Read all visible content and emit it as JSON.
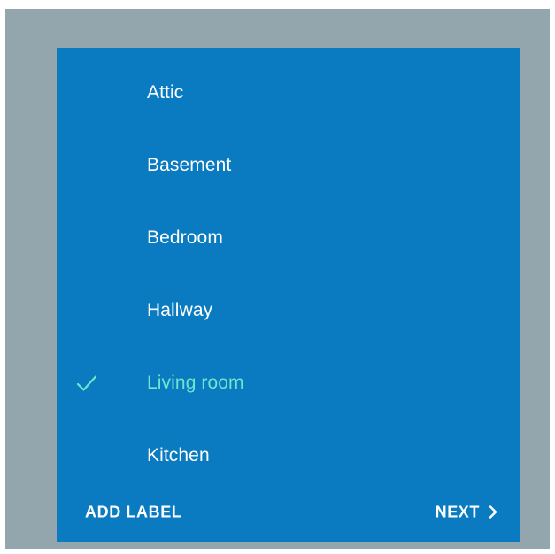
{
  "colors": {
    "frame": "#93a5ad",
    "card": "#0a7bc0",
    "text": "#ffffff",
    "selected": "#6ee5cc",
    "divider": "#3f9ad2"
  },
  "list": {
    "items": [
      {
        "label": "Attic",
        "selected": false
      },
      {
        "label": "Basement",
        "selected": false
      },
      {
        "label": "Bedroom",
        "selected": false
      },
      {
        "label": "Hallway",
        "selected": false
      },
      {
        "label": "Living room",
        "selected": true,
        "icon": "check-icon"
      },
      {
        "label": "Kitchen",
        "selected": false
      }
    ]
  },
  "footer": {
    "add_label": "ADD LABEL",
    "next_label": "NEXT",
    "next_icon": "chevron-right-icon"
  }
}
